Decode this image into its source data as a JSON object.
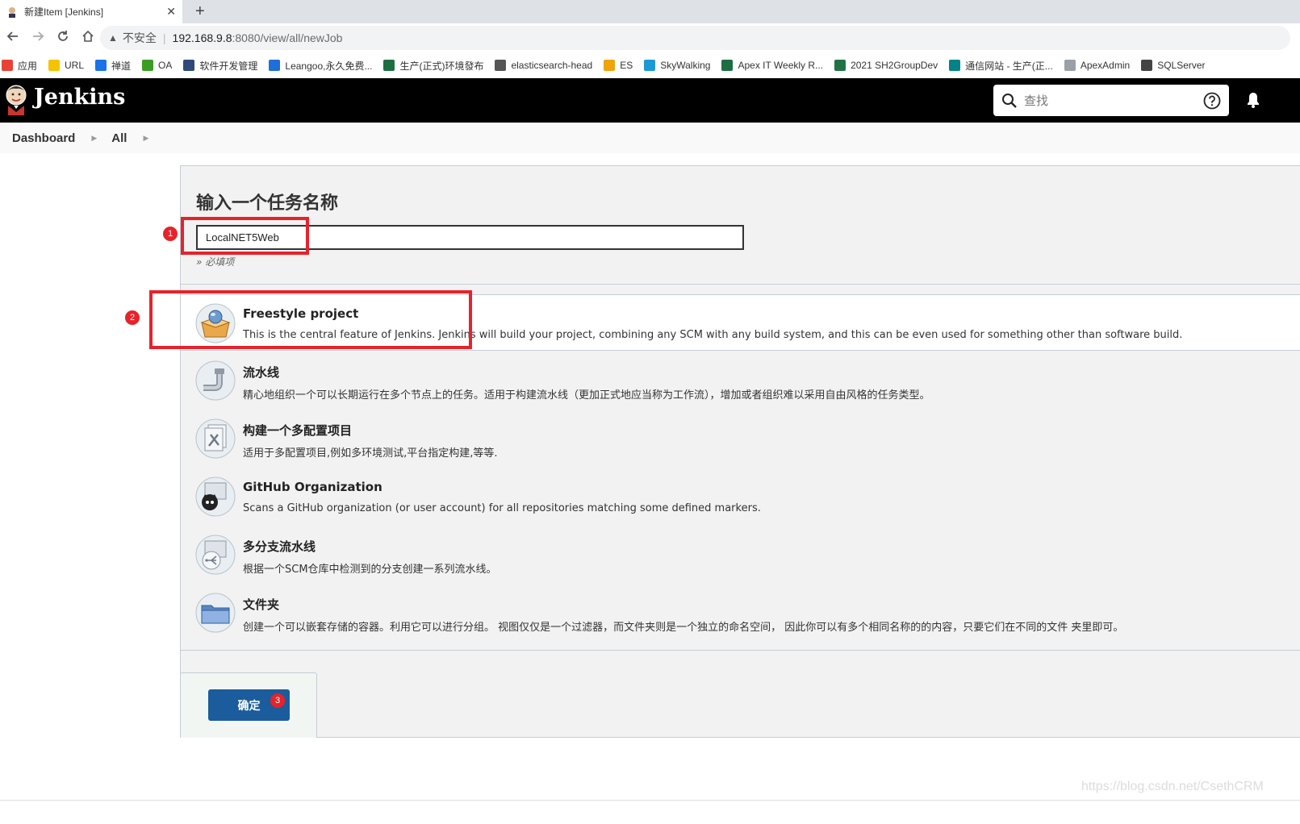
{
  "browser": {
    "tab_title": "新建Item [Jenkins]",
    "close_glyph": "✕",
    "new_tab_glyph": "+",
    "security_label": "不安全",
    "url_host": "192.168.9.8",
    "url_path": ":8080/view/all/newJob"
  },
  "bookmarks": [
    {
      "label": "应用",
      "icon": "apps-grid-icon",
      "color": "#e94235"
    },
    {
      "label": "URL",
      "icon": "folder-icon",
      "color": "#f5c400"
    },
    {
      "label": "禅道",
      "icon": "zentao-icon",
      "color": "#1a73e8"
    },
    {
      "label": "OA",
      "icon": "gear-icon",
      "color": "#3a9d23"
    },
    {
      "label": "软件开发管理",
      "icon": "an-icon",
      "color": "#2f4a7a"
    },
    {
      "label": "Leangoo,永久免费...",
      "icon": "leangoo-icon",
      "color": "#1e6fd9"
    },
    {
      "label": "生产(正式)环境發布",
      "icon": "excel-icon",
      "color": "#1d6f42"
    },
    {
      "label": "elasticsearch-head",
      "icon": "elastic-icon",
      "color": "#555555"
    },
    {
      "label": "ES",
      "icon": "es-icon",
      "color": "#f0a30a"
    },
    {
      "label": "SkyWalking",
      "icon": "skywalking-icon",
      "color": "#1a9ad6"
    },
    {
      "label": "Apex IT Weekly R...",
      "icon": "excel-icon",
      "color": "#1d6f42"
    },
    {
      "label": "2021 SH2GroupDev",
      "icon": "project-icon",
      "color": "#217346"
    },
    {
      "label": "通信网站 - 生产(正...",
      "icon": "sharepoint-icon",
      "color": "#038387"
    },
    {
      "label": "ApexAdmin",
      "icon": "page-icon",
      "color": "#9aa0a6"
    },
    {
      "label": "SQLServer",
      "icon": "sqlserver-icon",
      "color": "#444444"
    }
  ],
  "header": {
    "title": "Jenkins",
    "search_placeholder": "查找"
  },
  "breadcrumb": {
    "items": [
      "Dashboard",
      "All"
    ]
  },
  "form": {
    "title": "输入一个任务名称",
    "name_value": "LocalNET5Web",
    "required_hint": "» 必填项"
  },
  "job_types": [
    {
      "name": "Freestyle project",
      "desc": "This is the central feature of Jenkins. Jenkins will build your project, combining any SCM with any build system, and this can be even used for something other than software build.",
      "icon": "freestyle-package-icon"
    },
    {
      "name": "流水线",
      "desc": "精心地组织一个可以长期运行在多个节点上的任务。适用于构建流水线（更加正式地应当称为工作流），增加或者组织难以采用自由风格的任务类型。",
      "icon": "pipeline-icon"
    },
    {
      "name": "构建一个多配置项目",
      "desc": "适用于多配置项目,例如多环境测试,平台指定构建,等等.",
      "icon": "multi-config-icon"
    },
    {
      "name": "GitHub Organization",
      "desc": "Scans a GitHub organization (or user account) for all repositories matching some defined markers.",
      "icon": "github-org-icon"
    },
    {
      "name": "多分支流水线",
      "desc": "根据一个SCM仓库中检测到的分支创建一系列流水线。",
      "icon": "multibranch-icon"
    },
    {
      "name": "文件夹",
      "desc": "创建一个可以嵌套存储的容器。利用它可以进行分组。 视图仅仅是一个过滤器，而文件夹则是一个独立的命名空间， 因此你可以有多个相同名称的的内容，只要它们在不同的文件 夹里即可。",
      "icon": "folder-icon"
    }
  ],
  "actions": {
    "ok_label": "确定"
  },
  "annotations": {
    "marker_1": "1",
    "marker_2": "2",
    "marker_3": "3",
    "color": "#e8222a"
  },
  "watermark": "https://blog.csdn.net/CsethCRM"
}
